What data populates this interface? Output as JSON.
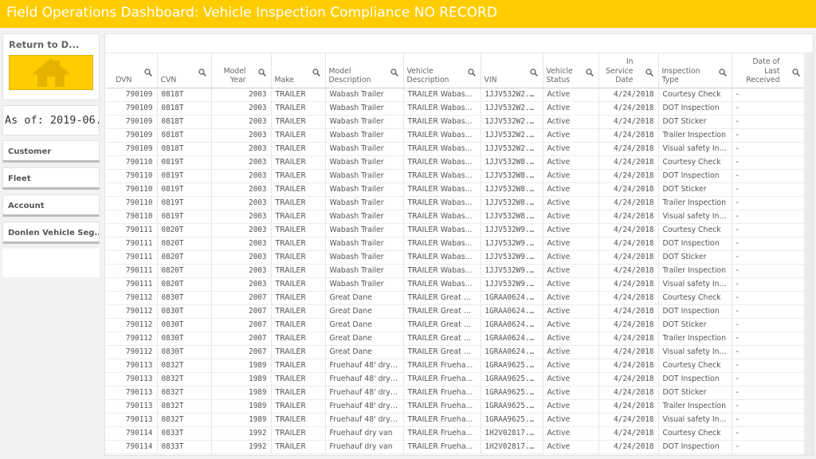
{
  "title": "Field Operations Dashboard: Vehicle Inspection Compliance NO RECORD",
  "sidebar": {
    "return_label": "Return to D...",
    "as_of": "As of: 2019-06...",
    "filters": [
      "Customer",
      "Fleet",
      "Account",
      "Donlen Vehicle Seg..."
    ]
  },
  "table": {
    "columns": [
      {
        "label": "DVN",
        "align": "right"
      },
      {
        "label": "CVN",
        "align": "left"
      },
      {
        "label": "Model Year",
        "align": "right"
      },
      {
        "label": "Make",
        "align": "left"
      },
      {
        "label": "Model Description",
        "align": "left"
      },
      {
        "label": "Vehicle Description",
        "align": "left"
      },
      {
        "label": "VIN",
        "align": "left"
      },
      {
        "label": "Vehicle Status",
        "align": "left"
      },
      {
        "label": "In Service Date",
        "align": "right"
      },
      {
        "label": "Inspection Type",
        "align": "left"
      },
      {
        "label": "Date of Last Received",
        "align": "right"
      }
    ],
    "rows": [
      [
        "790109",
        "0818T",
        "2003",
        "TRAILER",
        "Wabash Trailer",
        "TRAILER Wabas...",
        "1JJV532W2...",
        "Active",
        "4/24/2018",
        "Courtesy Check",
        "-"
      ],
      [
        "790109",
        "0818T",
        "2003",
        "TRAILER",
        "Wabash Trailer",
        "TRAILER Wabas...",
        "1JJV532W2...",
        "Active",
        "4/24/2018",
        "DOT Inspection",
        "-"
      ],
      [
        "790109",
        "0818T",
        "2003",
        "TRAILER",
        "Wabash Trailer",
        "TRAILER Wabas...",
        "1JJV532W2...",
        "Active",
        "4/24/2018",
        "DOT Sticker",
        "-"
      ],
      [
        "790109",
        "0818T",
        "2003",
        "TRAILER",
        "Wabash Trailer",
        "TRAILER Wabas...",
        "1JJV532W2...",
        "Active",
        "4/24/2018",
        "Trailer Inspection",
        "-"
      ],
      [
        "790109",
        "0818T",
        "2003",
        "TRAILER",
        "Wabash Trailer",
        "TRAILER Wabas...",
        "1JJV532W2...",
        "Active",
        "4/24/2018",
        "Visual safety Ins...",
        "-"
      ],
      [
        "790110",
        "0819T",
        "2003",
        "TRAILER",
        "Wabash Trailer",
        "TRAILER Wabas...",
        "1JJV532W8...",
        "Active",
        "4/24/2018",
        "Courtesy Check",
        "-"
      ],
      [
        "790110",
        "0819T",
        "2003",
        "TRAILER",
        "Wabash Trailer",
        "TRAILER Wabas...",
        "1JJV532W8...",
        "Active",
        "4/24/2018",
        "DOT Inspection",
        "-"
      ],
      [
        "790110",
        "0819T",
        "2003",
        "TRAILER",
        "Wabash Trailer",
        "TRAILER Wabas...",
        "1JJV532W8...",
        "Active",
        "4/24/2018",
        "DOT Sticker",
        "-"
      ],
      [
        "790110",
        "0819T",
        "2003",
        "TRAILER",
        "Wabash Trailer",
        "TRAILER Wabas...",
        "1JJV532W8...",
        "Active",
        "4/24/2018",
        "Trailer Inspection",
        "-"
      ],
      [
        "790110",
        "0819T",
        "2003",
        "TRAILER",
        "Wabash Trailer",
        "TRAILER Wabas...",
        "1JJV532W8...",
        "Active",
        "4/24/2018",
        "Visual safety Ins...",
        "-"
      ],
      [
        "790111",
        "0820T",
        "2003",
        "TRAILER",
        "Wabash Trailer",
        "TRAILER Wabas...",
        "1JJV532W9...",
        "Active",
        "4/24/2018",
        "Courtesy Check",
        "-"
      ],
      [
        "790111",
        "0820T",
        "2003",
        "TRAILER",
        "Wabash Trailer",
        "TRAILER Wabas...",
        "1JJV532W9...",
        "Active",
        "4/24/2018",
        "DOT Inspection",
        "-"
      ],
      [
        "790111",
        "0820T",
        "2003",
        "TRAILER",
        "Wabash Trailer",
        "TRAILER Wabas...",
        "1JJV532W9...",
        "Active",
        "4/24/2018",
        "DOT Sticker",
        "-"
      ],
      [
        "790111",
        "0820T",
        "2003",
        "TRAILER",
        "Wabash Trailer",
        "TRAILER Wabas...",
        "1JJV532W9...",
        "Active",
        "4/24/2018",
        "Trailer Inspection",
        "-"
      ],
      [
        "790111",
        "0820T",
        "2003",
        "TRAILER",
        "Wabash Trailer",
        "TRAILER Wabas...",
        "1JJV532W9...",
        "Active",
        "4/24/2018",
        "Visual safety Ins...",
        "-"
      ],
      [
        "790112",
        "0830T",
        "2007",
        "TRAILER",
        "Great Dane",
        "TRAILER Great D...",
        "1GRAA0624...",
        "Active",
        "4/24/2018",
        "Courtesy Check",
        "-"
      ],
      [
        "790112",
        "0830T",
        "2007",
        "TRAILER",
        "Great Dane",
        "TRAILER Great D...",
        "1GRAA0624...",
        "Active",
        "4/24/2018",
        "DOT Inspection",
        "-"
      ],
      [
        "790112",
        "0830T",
        "2007",
        "TRAILER",
        "Great Dane",
        "TRAILER Great D...",
        "1GRAA0624...",
        "Active",
        "4/24/2018",
        "DOT Sticker",
        "-"
      ],
      [
        "790112",
        "0830T",
        "2007",
        "TRAILER",
        "Great Dane",
        "TRAILER Great D...",
        "1GRAA0624...",
        "Active",
        "4/24/2018",
        "Trailer Inspection",
        "-"
      ],
      [
        "790112",
        "0830T",
        "2007",
        "TRAILER",
        "Great Dane",
        "TRAILER Great D...",
        "1GRAA0624...",
        "Active",
        "4/24/2018",
        "Visual safety Ins...",
        "-"
      ],
      [
        "790113",
        "0832T",
        "1989",
        "TRAILER",
        "Fruehauf 48' dry ...",
        "TRAILER Frueha...",
        "1GRAA9625...",
        "Active",
        "4/24/2018",
        "Courtesy Check",
        "-"
      ],
      [
        "790113",
        "0832T",
        "1989",
        "TRAILER",
        "Fruehauf 48' dry ...",
        "TRAILER Frueha...",
        "1GRAA9625...",
        "Active",
        "4/24/2018",
        "DOT Inspection",
        "-"
      ],
      [
        "790113",
        "0832T",
        "1989",
        "TRAILER",
        "Fruehauf 48' dry ...",
        "TRAILER Frueha...",
        "1GRAA9625...",
        "Active",
        "4/24/2018",
        "DOT Sticker",
        "-"
      ],
      [
        "790113",
        "0832T",
        "1989",
        "TRAILER",
        "Fruehauf 48' dry ...",
        "TRAILER Frueha...",
        "1GRAA9625...",
        "Active",
        "4/24/2018",
        "Trailer Inspection",
        "-"
      ],
      [
        "790113",
        "0832T",
        "1989",
        "TRAILER",
        "Fruehauf 48' dry ...",
        "TRAILER Frueha...",
        "1GRAA9625...",
        "Active",
        "4/24/2018",
        "Visual safety Ins...",
        "-"
      ],
      [
        "790114",
        "0833T",
        "1992",
        "TRAILER",
        "Fruehauf dry van",
        "TRAILER Frueha...",
        "1H2V02817...",
        "Active",
        "4/24/2018",
        "Courtesy Check",
        "-"
      ],
      [
        "790114",
        "0833T",
        "1992",
        "TRAILER",
        "Fruehauf dry van",
        "TRAILER Frueha...",
        "1H2V02817...",
        "Active",
        "4/24/2018",
        "DOT Inspection",
        "-"
      ]
    ]
  },
  "colors": {
    "brand": "#ffcc00",
    "header_text": "#ffffff"
  },
  "icons": {
    "return": "home-icon",
    "column_search": "search-icon"
  }
}
